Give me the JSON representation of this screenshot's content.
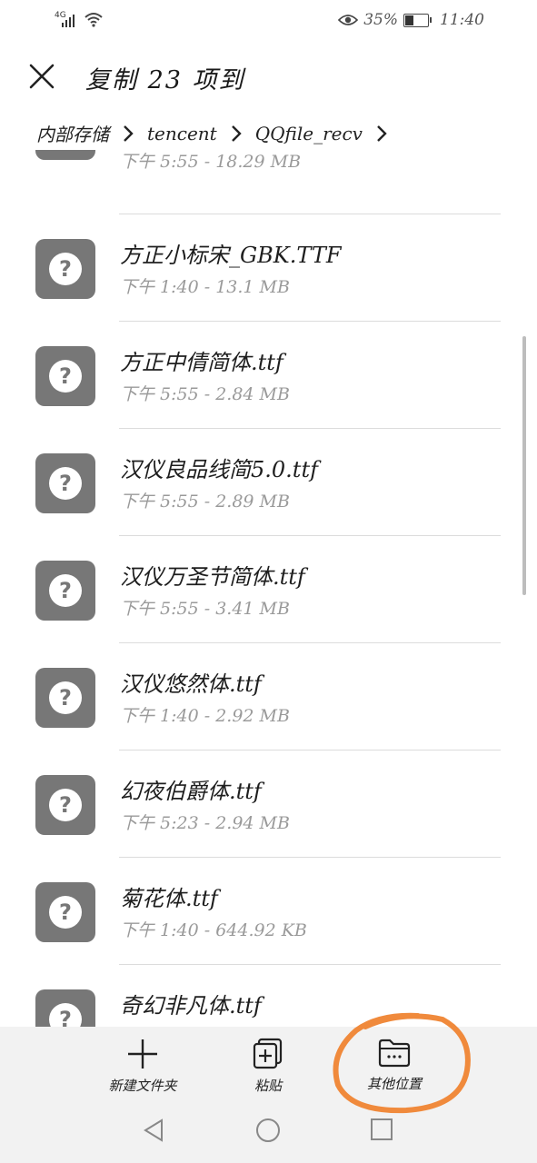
{
  "status_bar": {
    "network": "4G",
    "battery_percent": "35%",
    "time": "11:40",
    "battery_level": 0.35
  },
  "header": {
    "title": "复制 23 项到",
    "close_icon": "close-icon"
  },
  "breadcrumb": [
    "内部存储",
    "tencent",
    "QQfile_recv"
  ],
  "files": [
    {
      "name": "",
      "meta": "下午 5:55 - 18.29 MB"
    },
    {
      "name": "方正小标宋_GBK.TTF",
      "meta": "下午 1:40 - 13.1 MB"
    },
    {
      "name": "方正中倩简体.ttf",
      "meta": "下午 5:55 - 2.84 MB"
    },
    {
      "name": "汉仪良品线简5.0.ttf",
      "meta": "下午 5:55 - 2.89 MB"
    },
    {
      "name": "汉仪万圣节简体.ttf",
      "meta": "下午 5:55 - 3.41 MB"
    },
    {
      "name": "汉仪悠然体.ttf",
      "meta": "下午 1:40 - 2.92 MB"
    },
    {
      "name": "幻夜伯爵体.ttf",
      "meta": "下午 5:23 - 2.94 MB"
    },
    {
      "name": "菊花体.ttf",
      "meta": "下午 1:40 - 644.92 KB"
    },
    {
      "name": "奇幻非凡体.ttf",
      "meta": ""
    }
  ],
  "toolbar": {
    "new_folder": "新建文件夹",
    "paste": "粘贴",
    "other_location": "其他位置"
  },
  "colors": {
    "file_icon": "#777777",
    "annotation": "#f08a3c",
    "toolbar_bg": "#f2f2f2"
  }
}
